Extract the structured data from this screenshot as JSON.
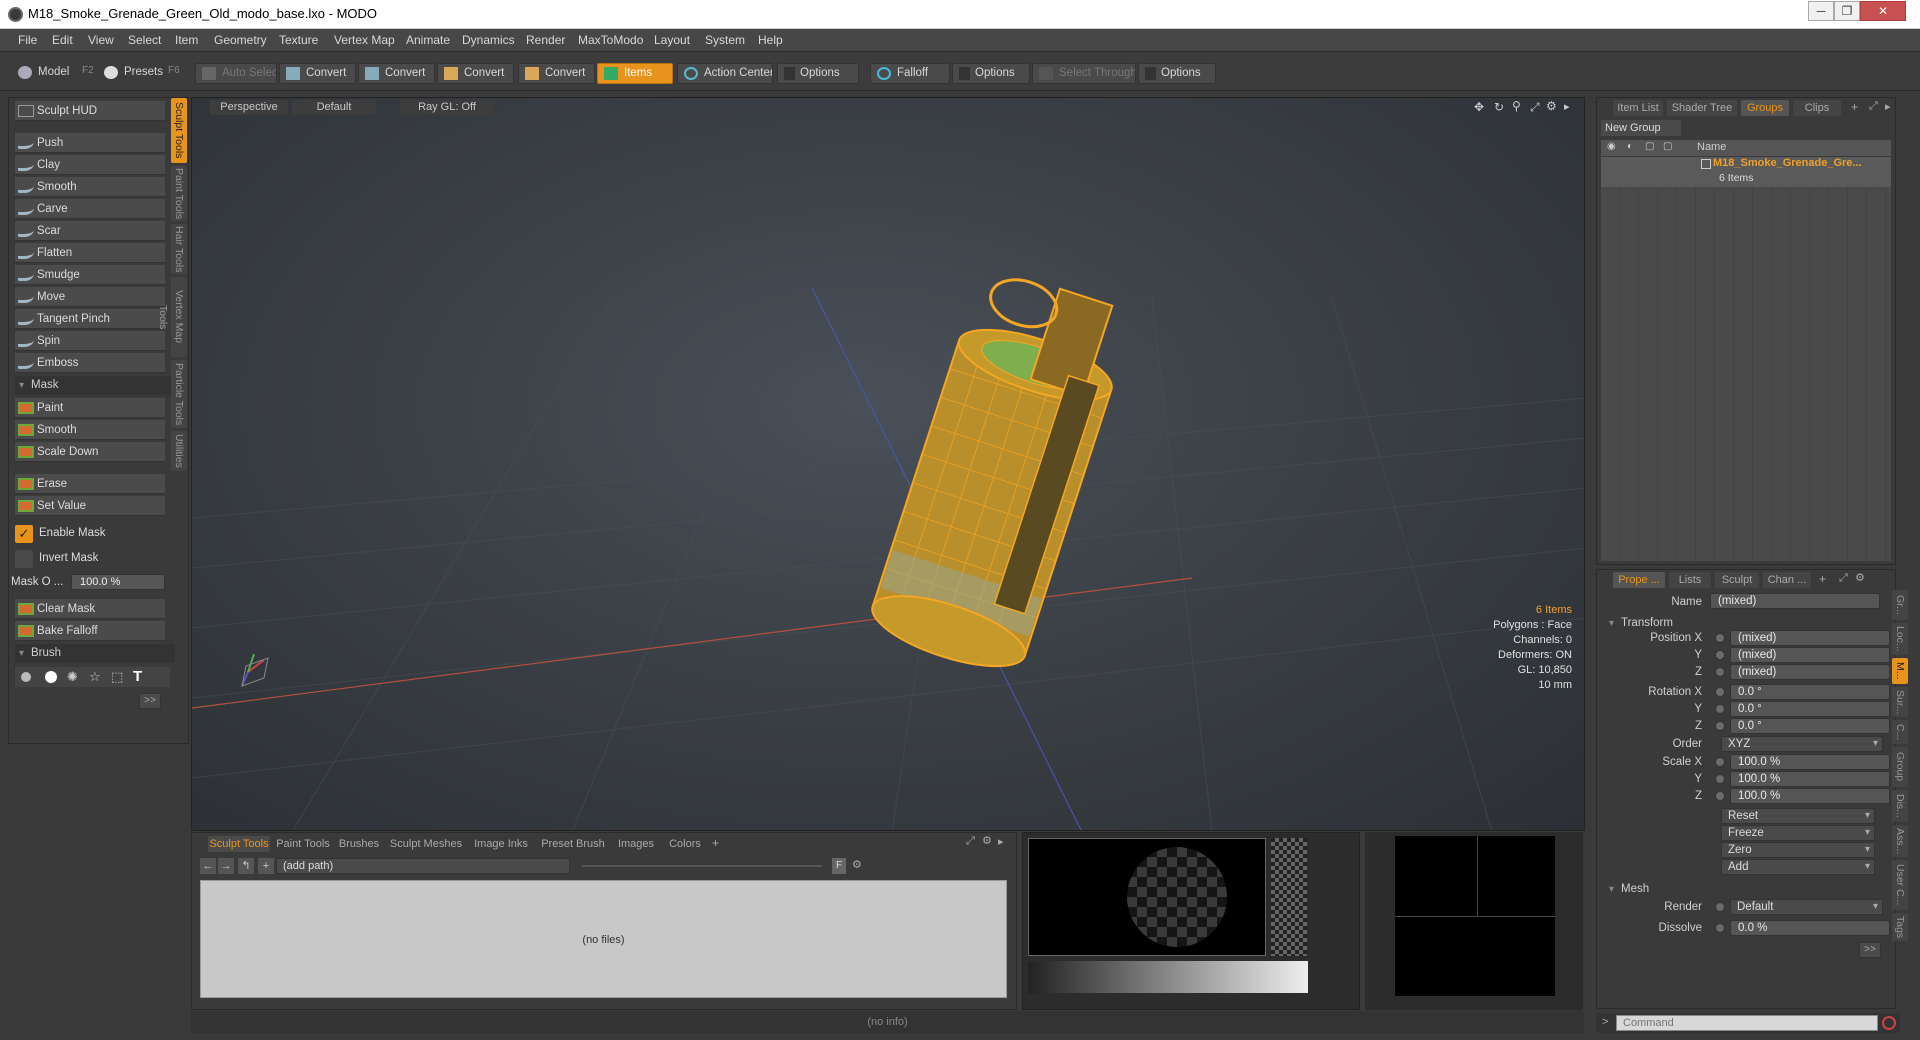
{
  "window": {
    "title": "M18_Smoke_Grenade_Green_Old_modo_base.lxo - MODO",
    "controls": [
      "─",
      "❐",
      "✕"
    ]
  },
  "menu": [
    "File",
    "Edit",
    "View",
    "Select",
    "Item",
    "Geometry",
    "Texture",
    "Vertex Map",
    "Animate",
    "Dynamics",
    "Render",
    "MaxToModo",
    "Layout",
    "System",
    "Help"
  ],
  "toolbar": {
    "model": "Model",
    "model_key": "F2",
    "presets": "Presets",
    "presets_key": "F6",
    "auto_select": "Auto Select",
    "convert1": "Convert",
    "convert2": "Convert",
    "convert3": "Convert",
    "convert4": "Convert",
    "items": "Items",
    "action_center": "Action Center",
    "options1": "Options",
    "falloff": "Falloff",
    "options2": "Options",
    "select_through": "Select Through",
    "options3": "Options"
  },
  "left_panel": {
    "hud": "Sculpt HUD",
    "tools": [
      "Push",
      "Clay",
      "Smooth",
      "Carve",
      "Scar",
      "Flatten",
      "Smudge",
      "Move",
      "Tangent Pinch",
      "Spin",
      "Emboss"
    ],
    "mask_section": "Mask",
    "mask_tools": [
      "Paint",
      "Smooth",
      "Scale Down"
    ],
    "erase": "Erase",
    "set_value": "Set Value",
    "enable_mask": "Enable Mask",
    "invert_mask": "Invert Mask",
    "mask_opacity_label": "Mask O ...",
    "mask_opacity_value": "100.0 %",
    "clear_mask": "Clear Mask",
    "bake_falloff": "Bake Falloff",
    "brush_section": "Brush",
    "more": ">>",
    "vertical_tabs": [
      "Sculpt Tools",
      "Paint Tools",
      "Hair Tools",
      "Vertex Map Tools",
      "Particle Tools",
      "Utilities"
    ]
  },
  "viewport": {
    "view": "Perspective",
    "shading": "Default",
    "raygl": "Ray GL: Off",
    "info": {
      "items": "6 Items",
      "polygons": "Polygons : Face",
      "channels": "Channels: 0",
      "deformers": "Deformers: ON",
      "gl": "GL: 10,850",
      "unit": "10 mm"
    }
  },
  "bottom_panel": {
    "tabs": [
      "Sculpt Tools",
      "Paint Tools",
      "Brushes",
      "Sculpt Meshes",
      "Image Inks",
      "Preset Brush",
      "Images",
      "Colors"
    ],
    "path": "(add path)",
    "empty": "(no files)",
    "f_btn": "F"
  },
  "status": "(no info)",
  "right_top": {
    "tabs": [
      "Item List",
      "Shader Tree",
      "Groups",
      "Clips"
    ],
    "new_group": "New Group",
    "column_name": "Name",
    "group_name": "M18_Smoke_Grenade_Gre...",
    "group_count": "6 Items"
  },
  "properties": {
    "tabs": [
      "Prope ...",
      "Lists",
      "Sculpt",
      "Chan ..."
    ],
    "name_label": "Name",
    "name_value": "(mixed)",
    "transform_section": "Transform",
    "pos_x_label": "Position X",
    "pos_x": "(mixed)",
    "pos_y_label": "Y",
    "pos_y": "(mixed)",
    "pos_z_label": "Z",
    "pos_z": "(mixed)",
    "rot_x_label": "Rotation X",
    "rot_x": "0.0 °",
    "rot_y_label": "Y",
    "rot_y": "0.0 °",
    "rot_z_label": "Z",
    "rot_z": "0.0 °",
    "order_label": "Order",
    "order": "XYZ",
    "scale_x_label": "Scale X",
    "scale_x": "100.0 %",
    "scale_y_label": "Y",
    "scale_y": "100.0 %",
    "scale_z_label": "Z",
    "scale_z": "100.0 %",
    "reset": "Reset",
    "freeze": "Freeze",
    "zero": "Zero",
    "add": "Add",
    "mesh_section": "Mesh",
    "render_label": "Render",
    "render": "Default",
    "dissolve_label": "Dissolve",
    "dissolve": "0.0 %",
    "more": ">>",
    "vertical_tabs": [
      "Gr...",
      "Loc...",
      "M...",
      "Sur...",
      "C...",
      "Group",
      "Dis...",
      "Ass...",
      "User C...",
      "Tags"
    ]
  },
  "command": {
    "placeholder": "Command",
    "prompt": ">"
  },
  "colors": {
    "accent": "#e8941c",
    "mesh": "#f5a623"
  }
}
